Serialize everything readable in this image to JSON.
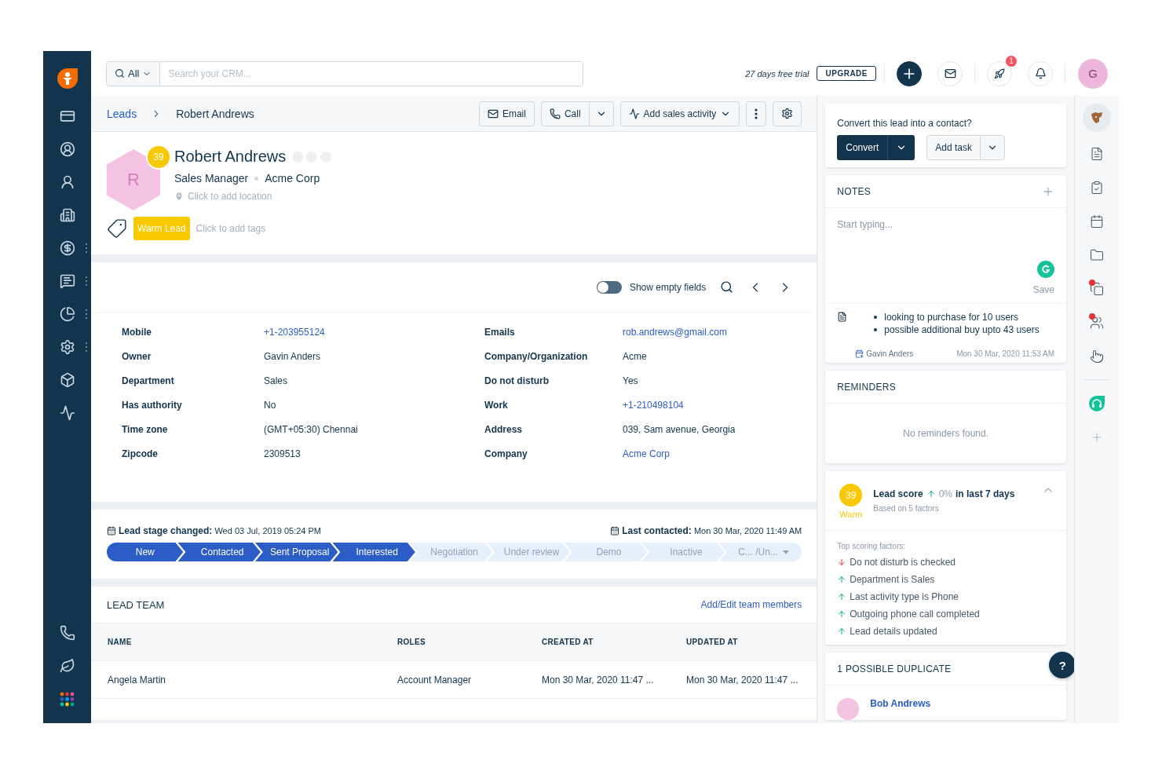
{
  "search": {
    "scope": "All",
    "placeholder": "Search your CRM..."
  },
  "topbar": {
    "trial": "27 days free trial",
    "upgrade": "UPGRADE",
    "notification_count": "1",
    "avatar": "G"
  },
  "breadcrumb": [
    "Leads",
    "Robert Andrews"
  ],
  "actions": {
    "email": "Email",
    "call": "Call",
    "activity": "Add sales activity"
  },
  "lead": {
    "initial": "R",
    "score": "39",
    "name": "Robert Andrews",
    "title": "Sales Manager",
    "company": "Acme Corp",
    "location_placeholder": "Click to add location",
    "tags": [
      "Warm Lead"
    ],
    "tags_placeholder": "Click to add tags"
  },
  "show_empty": {
    "label": "Show empty fields",
    "on": false
  },
  "fields": [
    {
      "label": "Mobile",
      "value": "+1-203955124",
      "link": true
    },
    {
      "label": "Emails",
      "value": "rob.andrews@gmail.com",
      "link": true
    },
    {
      "label": "Owner",
      "value": "Gavin Anders",
      "link": false
    },
    {
      "label": "Company/Organization",
      "value": "Acme",
      "link": false
    },
    {
      "label": "Department",
      "value": "Sales",
      "link": false
    },
    {
      "label": "Do not disturb",
      "value": "Yes",
      "link": false
    },
    {
      "label": "Has authority",
      "value": "No",
      "link": false
    },
    {
      "label": "Work",
      "value": "+1-210498104",
      "link": true
    },
    {
      "label": "Time zone",
      "value": "(GMT+05:30) Chennai",
      "link": false
    },
    {
      "label": "Address",
      "value": "039, Sam avenue, Georgia",
      "link": false
    },
    {
      "label": "Zipcode",
      "value": "2309513",
      "link": false
    },
    {
      "label": "Company",
      "value": "Acme Corp",
      "link": true
    }
  ],
  "stage": {
    "changed_label": "Lead stage changed:",
    "changed": "Wed 03 Jul, 2019 05:24 PM",
    "contacted_label": "Last contacted:",
    "contacted": "Mon 30 Mar, 2020 11:49 AM",
    "stages": [
      {
        "label": "New",
        "reached": true
      },
      {
        "label": "Contacted",
        "reached": true
      },
      {
        "label": "Sent Proposal",
        "reached": true
      },
      {
        "label": "Interested",
        "reached": true
      },
      {
        "label": "Negotiation",
        "reached": false
      },
      {
        "label": "Under review",
        "reached": false
      },
      {
        "label": "Demo",
        "reached": false
      },
      {
        "label": "Inactive",
        "reached": false
      },
      {
        "label": "C... /Un...",
        "reached": false
      }
    ]
  },
  "team": {
    "title": "LEAD TEAM",
    "action": "Add/Edit team members",
    "columns": [
      "NAME",
      "ROLES",
      "CREATED AT",
      "UPDATED AT"
    ],
    "rows": [
      [
        "Angela Martin",
        "Account Manager",
        "Mon 30 Mar, 2020 11:47 ...",
        "Mon 30 Mar, 2020 11:47 ..."
      ]
    ]
  },
  "convert": {
    "question": "Convert this lead into a contact?",
    "primary": "Convert",
    "secondary": "Add task"
  },
  "notes": {
    "title": "NOTES",
    "placeholder": "Start typing...",
    "save": "Save",
    "items": [
      {
        "bullets": [
          "looking to purchase for 10 users",
          "possible additional buy upto 43 users"
        ],
        "author": "Gavin Anders",
        "time": "Mon 30 Mar, 2020 11:53 AM"
      }
    ]
  },
  "reminders": {
    "title": "REMINDERS",
    "empty": "No reminders found."
  },
  "score": {
    "value": "39",
    "label": "Warm",
    "title": "Lead score",
    "change": "0%",
    "period": "in last 7 days",
    "basis": "Based on 5 factors",
    "expanded": true,
    "factors_title": "Top scoring factors:",
    "factors": [
      {
        "text": "Do not disturb is checked",
        "kind": "negative"
      },
      {
        "text": "Department is Sales",
        "kind": "positive"
      },
      {
        "text": "Last activity type is Phone",
        "kind": "positive"
      },
      {
        "text": "Outgoing phone call completed",
        "kind": "positive"
      },
      {
        "text": "Lead details updated",
        "kind": "positive"
      }
    ]
  },
  "duplicates": {
    "title": "1 POSSIBLE DUPLICATE",
    "items": [
      {
        "name": "Bob Andrews"
      }
    ]
  },
  "help": "?"
}
